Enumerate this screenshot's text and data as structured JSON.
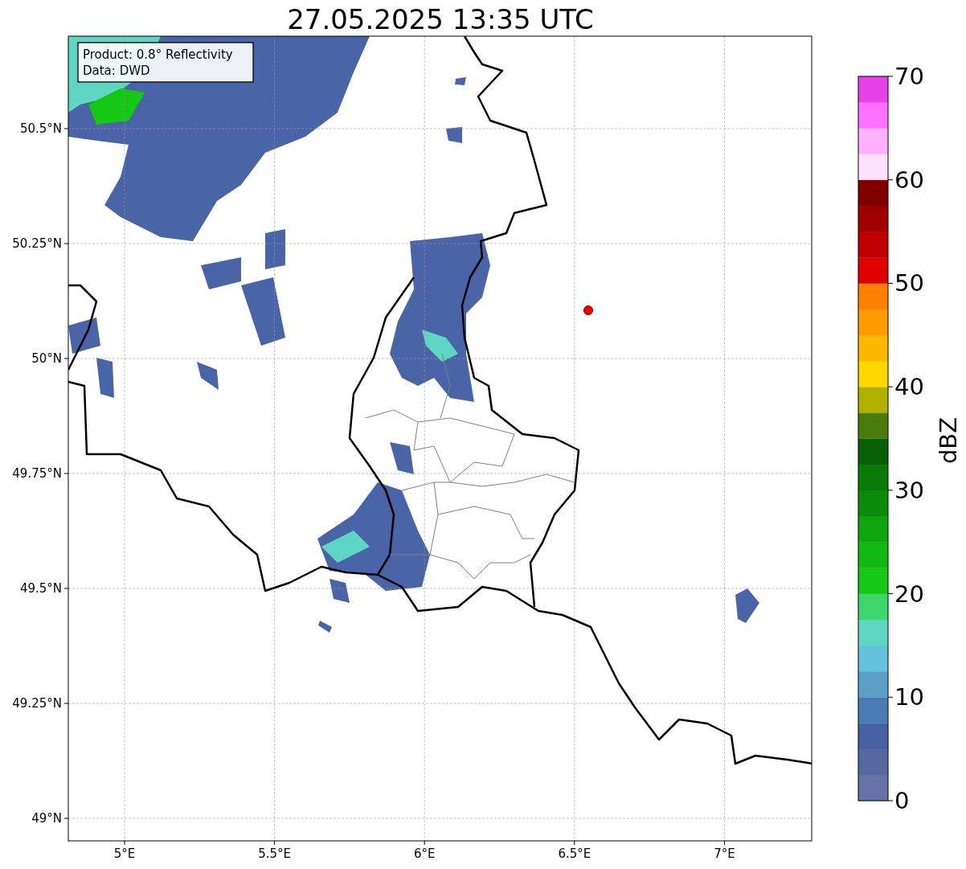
{
  "title": "27.05.2025 13:35 UTC",
  "info_box": {
    "lines": [
      "Product: 0.8° Reflectivity",
      "Data: DWD"
    ]
  },
  "map": {
    "xticks": [
      "5°E",
      "5.5°E",
      "6°E",
      "6.5°E",
      "7°E"
    ],
    "yticks": [
      "50.5°N",
      "50.25°N",
      "50°N",
      "49.75°N",
      "49.5°N",
      "49.25°N",
      "49°N"
    ]
  },
  "colorbar": {
    "label": "dBZ",
    "ticks": [
      "70",
      "60",
      "50",
      "40",
      "30",
      "20",
      "10",
      "0"
    ],
    "bands": [
      {
        "color": "#6473a6"
      },
      {
        "color": "#5668a0"
      },
      {
        "color": "#4560a3"
      },
      {
        "color": "#4a7bb3"
      },
      {
        "color": "#5a9fc6"
      },
      {
        "color": "#66c1dc"
      },
      {
        "color": "#5ed6c3"
      },
      {
        "color": "#3dd66e"
      },
      {
        "color": "#14c814"
      },
      {
        "color": "#10b810"
      },
      {
        "color": "#0ea50e"
      },
      {
        "color": "#0a8c0a"
      },
      {
        "color": "#087a08"
      },
      {
        "color": "#066006"
      },
      {
        "color": "#4a7a0a"
      },
      {
        "color": "#b0b000"
      },
      {
        "color": "#ffd700"
      },
      {
        "color": "#ffb800"
      },
      {
        "color": "#ff9a00"
      },
      {
        "color": "#ff7f00"
      },
      {
        "color": "#e00000"
      },
      {
        "color": "#c00000"
      },
      {
        "color": "#a00000"
      },
      {
        "color": "#800000"
      },
      {
        "color": "#ffe0ff"
      },
      {
        "color": "#ffb0ff"
      },
      {
        "color": "#ff70ff"
      },
      {
        "color": "#e840e8"
      }
    ]
  }
}
